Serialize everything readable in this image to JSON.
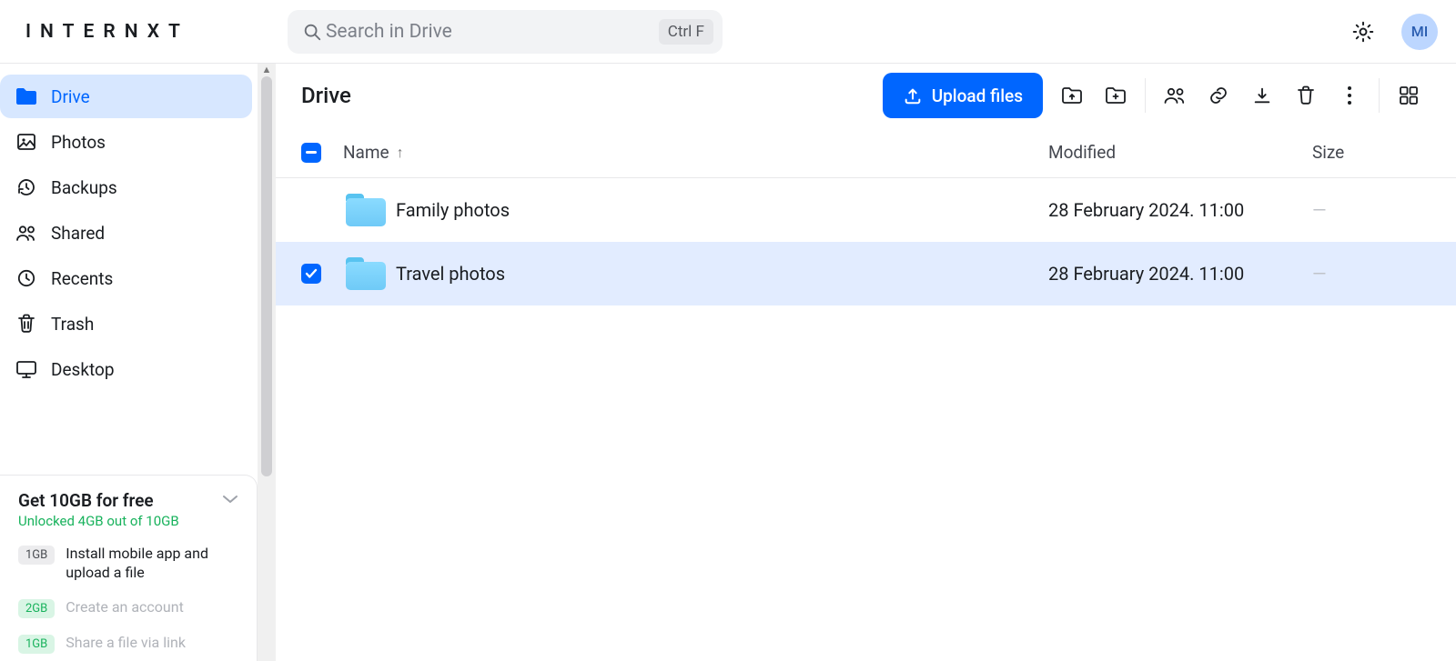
{
  "brand": "INTERNXT",
  "search": {
    "placeholder": "Search in Drive",
    "shortcut": "Ctrl F"
  },
  "avatar_initials": "MI",
  "sidebar": {
    "items": [
      {
        "label": "Drive"
      },
      {
        "label": "Photos"
      },
      {
        "label": "Backups"
      },
      {
        "label": "Shared"
      },
      {
        "label": "Recents"
      },
      {
        "label": "Trash"
      },
      {
        "label": "Desktop"
      }
    ]
  },
  "promo": {
    "title": "Get 10GB for free",
    "subtitle": "Unlocked 4GB out of 10GB",
    "tasks": [
      {
        "badge": "1GB",
        "desc": "Install mobile app and upload a file",
        "done": false
      },
      {
        "badge": "2GB",
        "desc": "Create an account",
        "done": true
      },
      {
        "badge": "1GB",
        "desc": "Share a file via link",
        "done": true
      }
    ]
  },
  "header": {
    "breadcrumb": "Drive",
    "upload_label": "Upload files"
  },
  "columns": {
    "name": "Name",
    "modified": "Modified",
    "size": "Size"
  },
  "rows": [
    {
      "name": "Family photos",
      "modified": "28 February 2024. 11:00",
      "size": "—",
      "selected": false
    },
    {
      "name": "Travel photos",
      "modified": "28 February 2024. 11:00",
      "size": "—",
      "selected": true
    }
  ]
}
